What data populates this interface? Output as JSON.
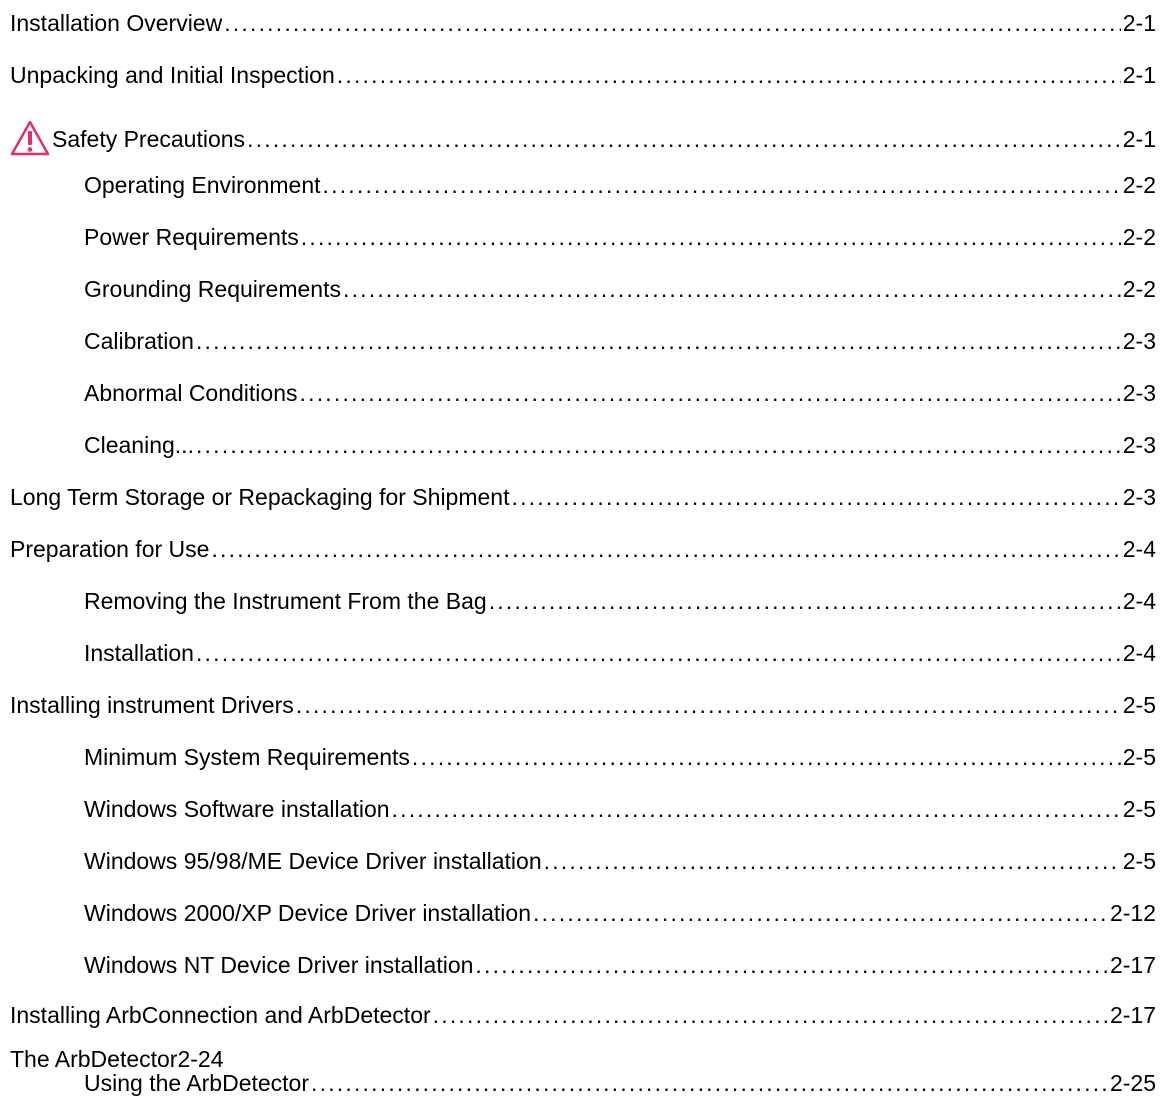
{
  "toc": [
    {
      "title": "Installation Overview",
      "page": "2-1"
    },
    {
      "title": "Unpacking and Initial Inspection",
      "page": "2-1"
    },
    {
      "title": "Safety Precautions",
      "page": "2-1",
      "icon": "warning-triangle-icon"
    },
    {
      "title": "Operating Environment",
      "page": "2-2"
    },
    {
      "title": "Power Requirements",
      "page": "2-2"
    },
    {
      "title": "Grounding Requirements",
      "page": "2-2"
    },
    {
      "title": "Calibration",
      "page": "2-3"
    },
    {
      "title": "Abnormal Conditions",
      "page": "2-3"
    },
    {
      "title": "Cleaning...",
      "page": "2-3"
    },
    {
      "title": "Long Term Storage or Repackaging for Shipment",
      "page": "2-3"
    },
    {
      "title": "Preparation for Use",
      "page": "2-4"
    },
    {
      "title": "Removing the Instrument From the Bag",
      "page": "2-4"
    },
    {
      "title": "Installation",
      "page": "2-4"
    },
    {
      "title": "Installing instrument Drivers",
      "page": "2-5"
    },
    {
      "title": "Minimum System Requirements",
      "page": "2-5"
    },
    {
      "title": "Windows Software installation",
      "page": "2-5"
    },
    {
      "title": "Windows 95/98/ME Device Driver installation",
      "page": "2-5"
    },
    {
      "title": "Windows 2000/XP Device Driver installation",
      "page": "2-12"
    },
    {
      "title": "Windows NT Device Driver installation",
      "page": "2-17"
    },
    {
      "title": "Installing ArbConnection and ArbDetector",
      "page": "2-17"
    },
    {
      "title": "The ArbDetector2-24"
    },
    {
      "title": "Using the ArbDetector",
      "page": "2-25"
    }
  ],
  "colors": {
    "warning_icon": "#e0306a"
  }
}
